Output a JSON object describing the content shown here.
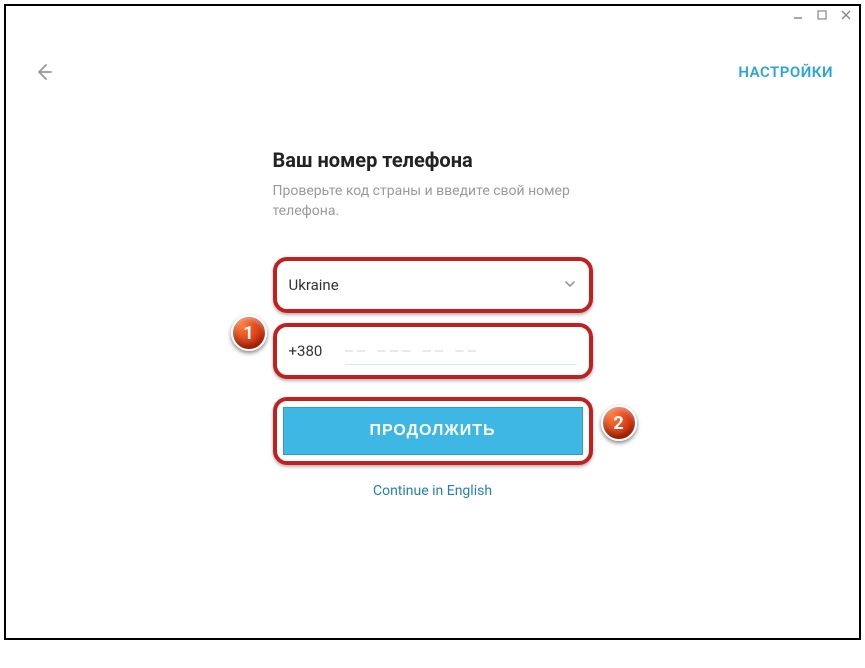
{
  "window": {
    "minimize": "–",
    "maximize": "☐",
    "close": "✕"
  },
  "header": {
    "settings": "НАСТРОЙКИ"
  },
  "page": {
    "title": "Ваш номер телефона",
    "subtitle": "Проверьте код страны и введите свой номер телефона."
  },
  "country": {
    "selected": "Ukraine"
  },
  "phone": {
    "code": "+380",
    "placeholder": "–– ––– –– ––",
    "value": ""
  },
  "actions": {
    "continue": "ПРОДОЛЖИТЬ",
    "lang_link": "Continue in English"
  },
  "annotations": {
    "badge1": "1",
    "badge2": "2"
  }
}
